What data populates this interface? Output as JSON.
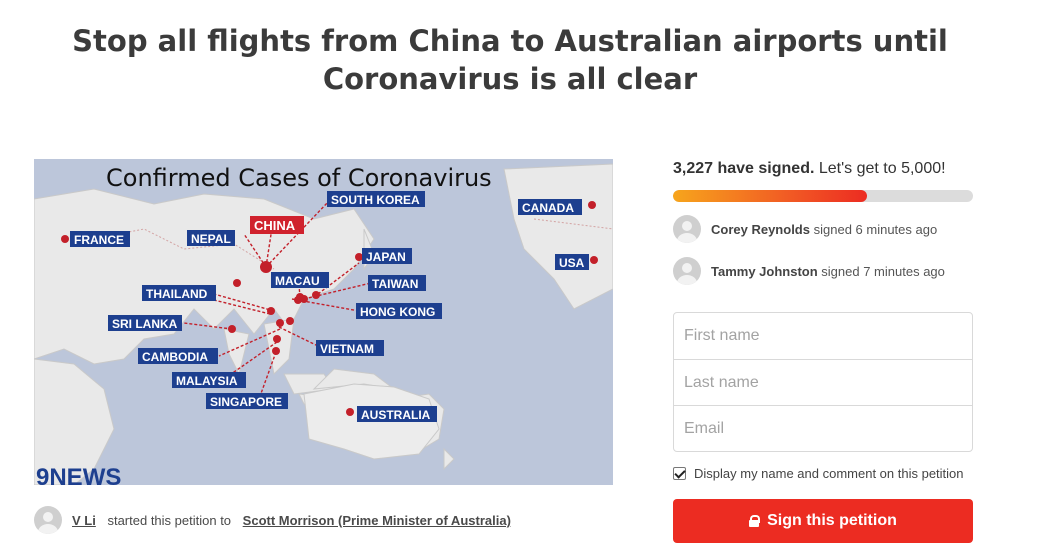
{
  "petition": {
    "title": "Stop all flights from China to Australian airports until Coronavirus is all clear"
  },
  "image": {
    "heading": "Confirmed Cases of Coronavirus",
    "logo": "9NEWS",
    "labels": {
      "france": "FRANCE",
      "nepal": "NEPAL",
      "china": "CHINA",
      "south_korea": "SOUTH KOREA",
      "canada": "CANADA",
      "japan": "JAPAN",
      "usa": "USA",
      "macau": "MACAU",
      "taiwan": "TAIWAN",
      "thailand": "THAILAND",
      "hong_kong": "HONG KONG",
      "sri_lanka": "SRI LANKA",
      "vietnam": "VIETNAM",
      "cambodia": "CAMBODIA",
      "malaysia": "MALAYSIA",
      "singapore": "SINGAPORE",
      "australia": "AUSTRALIA"
    }
  },
  "starter": {
    "name": "V Li",
    "text": "started this petition to",
    "target": "Scott Morrison (Prime Minister of Australia)"
  },
  "signatures": {
    "count_text": "3,227 have signed.",
    "goal_text": "Let's get to 5,000!",
    "progress_fraction": 0.6454
  },
  "recent_signers": [
    {
      "name": "Corey Reynolds",
      "time": "signed 6 minutes ago"
    },
    {
      "name": "Tammy Johnston",
      "time": "signed 7 minutes ago"
    }
  ],
  "form": {
    "first_name_placeholder": "First name",
    "last_name_placeholder": "Last name",
    "email_placeholder": "Email",
    "consent_label": "Display my name and comment on this petition",
    "consent_checked": true,
    "submit_label": "Sign this petition"
  },
  "colors": {
    "accent": "#ec2c22",
    "label_bg": "#1d3f8f",
    "china_label_bg": "#d0222d"
  }
}
